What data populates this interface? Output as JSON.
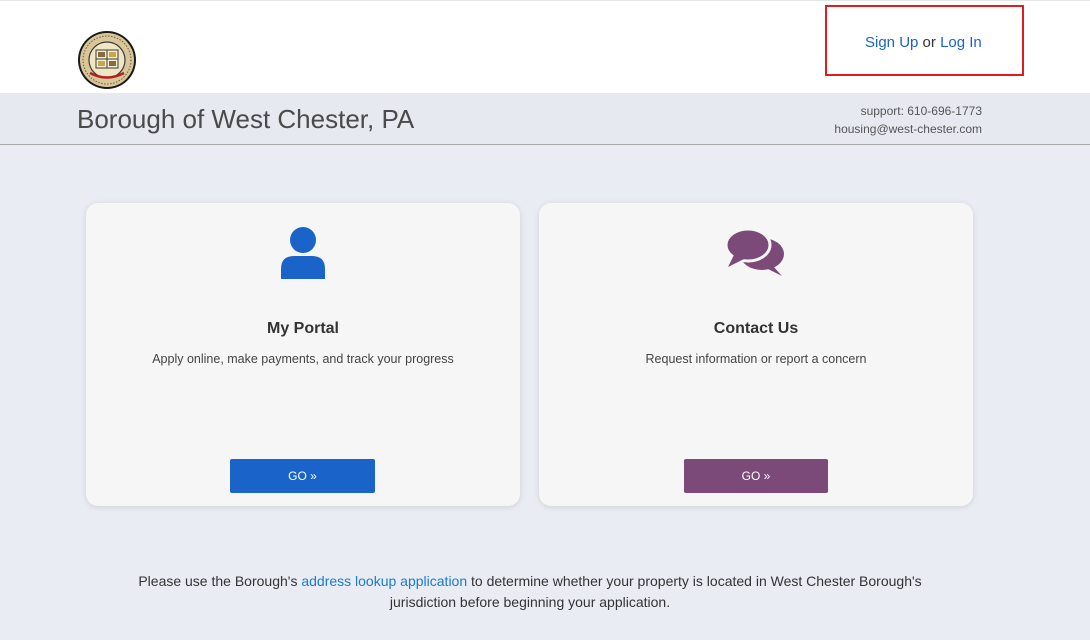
{
  "header": {
    "logo_icon": "borough-seal-icon",
    "auth": {
      "sign_up": "Sign Up",
      "or": "or",
      "log_in": "Log In"
    },
    "highlight_color": "#e21c1c"
  },
  "banner": {
    "title": "Borough of West Chester, PA",
    "support_phone": "support: 610-696-1773",
    "support_email": "housing@west-chester.com"
  },
  "cards": [
    {
      "icon": "user-icon",
      "title": "My Portal",
      "description": "Apply online, make payments, and track your progress",
      "button": "GO »",
      "color": "#1a64c9"
    },
    {
      "icon": "chat-bubbles-icon",
      "title": "Contact Us",
      "description": "Request information or report a concern",
      "button": "GO »",
      "color": "#7b4a78"
    }
  ],
  "footer": {
    "before_link": "Please use the Borough's",
    "link": "address lookup application",
    "after_link": "to determine whether your property is located in West Chester Borough's",
    "line2": "jurisdiction before beginning your application."
  }
}
